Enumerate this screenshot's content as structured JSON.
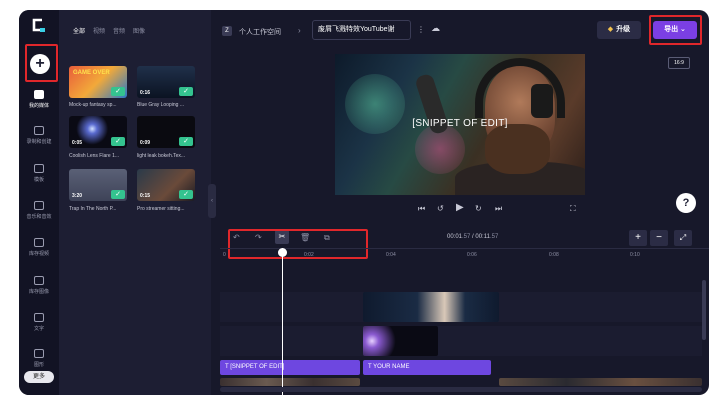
{
  "app": {
    "logo_letter": "C",
    "add_label": "+",
    "more_label": "更多",
    "colors": {
      "accent": "#7b3fe4",
      "background": "#17182a",
      "panel": "#1d1e33",
      "rail": "#121324",
      "highlight_box": "#e0272b",
      "success": "#34c38f"
    }
  },
  "rail": {
    "items": [
      {
        "label": "我的媒体",
        "icon": "folder-icon",
        "active": true
      },
      {
        "label": "录制和创建",
        "icon": "record-icon",
        "active": false
      },
      {
        "label": "模板",
        "icon": "templates-icon",
        "active": false
      },
      {
        "label": "音乐和音效",
        "icon": "music-icon",
        "active": false
      },
      {
        "label": "库存视频",
        "icon": "stock-video-icon",
        "active": false
      },
      {
        "label": "库存图像",
        "icon": "stock-image-icon",
        "active": false
      },
      {
        "label": "文字",
        "icon": "text-icon",
        "active": false
      },
      {
        "label": "图形",
        "icon": "graphics-icon",
        "active": false
      }
    ]
  },
  "media": {
    "tabs": [
      "全部",
      "视频",
      "音频",
      "图像"
    ],
    "active_tab": "全部",
    "items": [
      {
        "title": "Mock-up fantasy sp...",
        "duration": "",
        "thumb_text": "GAME OVER",
        "icon": "game-thumbnail"
      },
      {
        "title": "Blue Gray Looping ...",
        "duration": "0:16",
        "icon": "video-thumbnail"
      },
      {
        "title": "Coolish Lens Flare 1...",
        "duration": "0:05",
        "icon": "video-thumbnail"
      },
      {
        "title": "light leak bokeh.Tex...",
        "duration": "0:09",
        "icon": "video-thumbnail"
      },
      {
        "title": "Trap In The North P...",
        "duration": "3:20",
        "icon": "audio-thumbnail"
      },
      {
        "title": "Pro streamer sitting...",
        "duration": "0:15",
        "icon": "video-thumbnail"
      }
    ]
  },
  "topbar": {
    "workspace_letter": "Z",
    "workspace_name": "个人工作空间",
    "separator": "›",
    "project_name": "废屑飞溅特效YouTube谢",
    "menu_icon": "kebab-menu-icon",
    "sync_icon": "cloud-off-icon",
    "upgrade_label": "升级",
    "export_label": "导出",
    "aspect_ratio": "16:9"
  },
  "preview": {
    "overlay_text": "[SNIPPET OF EDIT]",
    "controls": [
      "skip-back-icon",
      "rewind-5-icon",
      "play-icon",
      "forward-5-icon",
      "skip-forward-icon",
      "fullscreen-icon"
    ],
    "help_label": "?"
  },
  "timeline": {
    "tools": [
      "undo-icon",
      "redo-icon",
      "scissors-icon",
      "delete-icon",
      "duplicate-icon"
    ],
    "current_time": "00:01",
    "current_frac": ".57",
    "separator": " / ",
    "total_time": "00:11",
    "total_frac": ".57",
    "ruler_ticks": [
      "0",
      "0:02",
      "0:04",
      "0:06",
      "0:08",
      "0:10"
    ],
    "text_clips": [
      "[SNIPPET OF EDIT]",
      "YOUR NAME"
    ],
    "zoom_in_label": "+",
    "zoom_out_label": "−"
  }
}
